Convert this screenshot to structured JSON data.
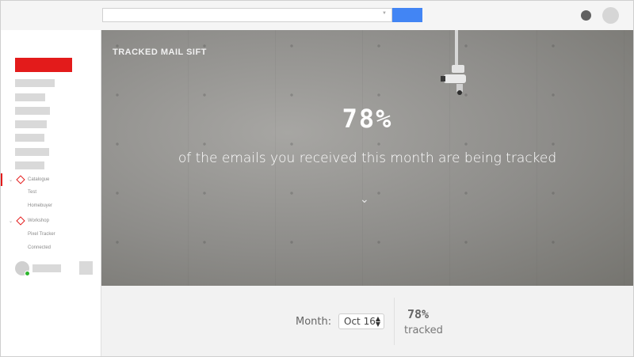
{
  "browser": {
    "search": {
      "value": "",
      "placeholder": ""
    }
  },
  "sidebar": {
    "tree": [
      {
        "label": "Catalogue",
        "expanded": true,
        "active": true,
        "children": [
          "Test",
          "Homebuyer"
        ]
      },
      {
        "label": "Workshop",
        "expanded": true,
        "active": false,
        "children": [
          "Pixel Tracker",
          "Connected"
        ]
      }
    ]
  },
  "hero": {
    "brand": "TRACKED MAIL SIFT",
    "percent": "78%",
    "caption": "of the emails you received this month are being tracked",
    "icon": "chevron-down-icon"
  },
  "summary": {
    "month_label": "Month:",
    "month_value": "Oct 16",
    "stat_value": "78%",
    "stat_label": "tracked"
  },
  "colors": {
    "accent": "#e31b1b",
    "search_button": "#4285f4",
    "online": "#2db52d"
  }
}
